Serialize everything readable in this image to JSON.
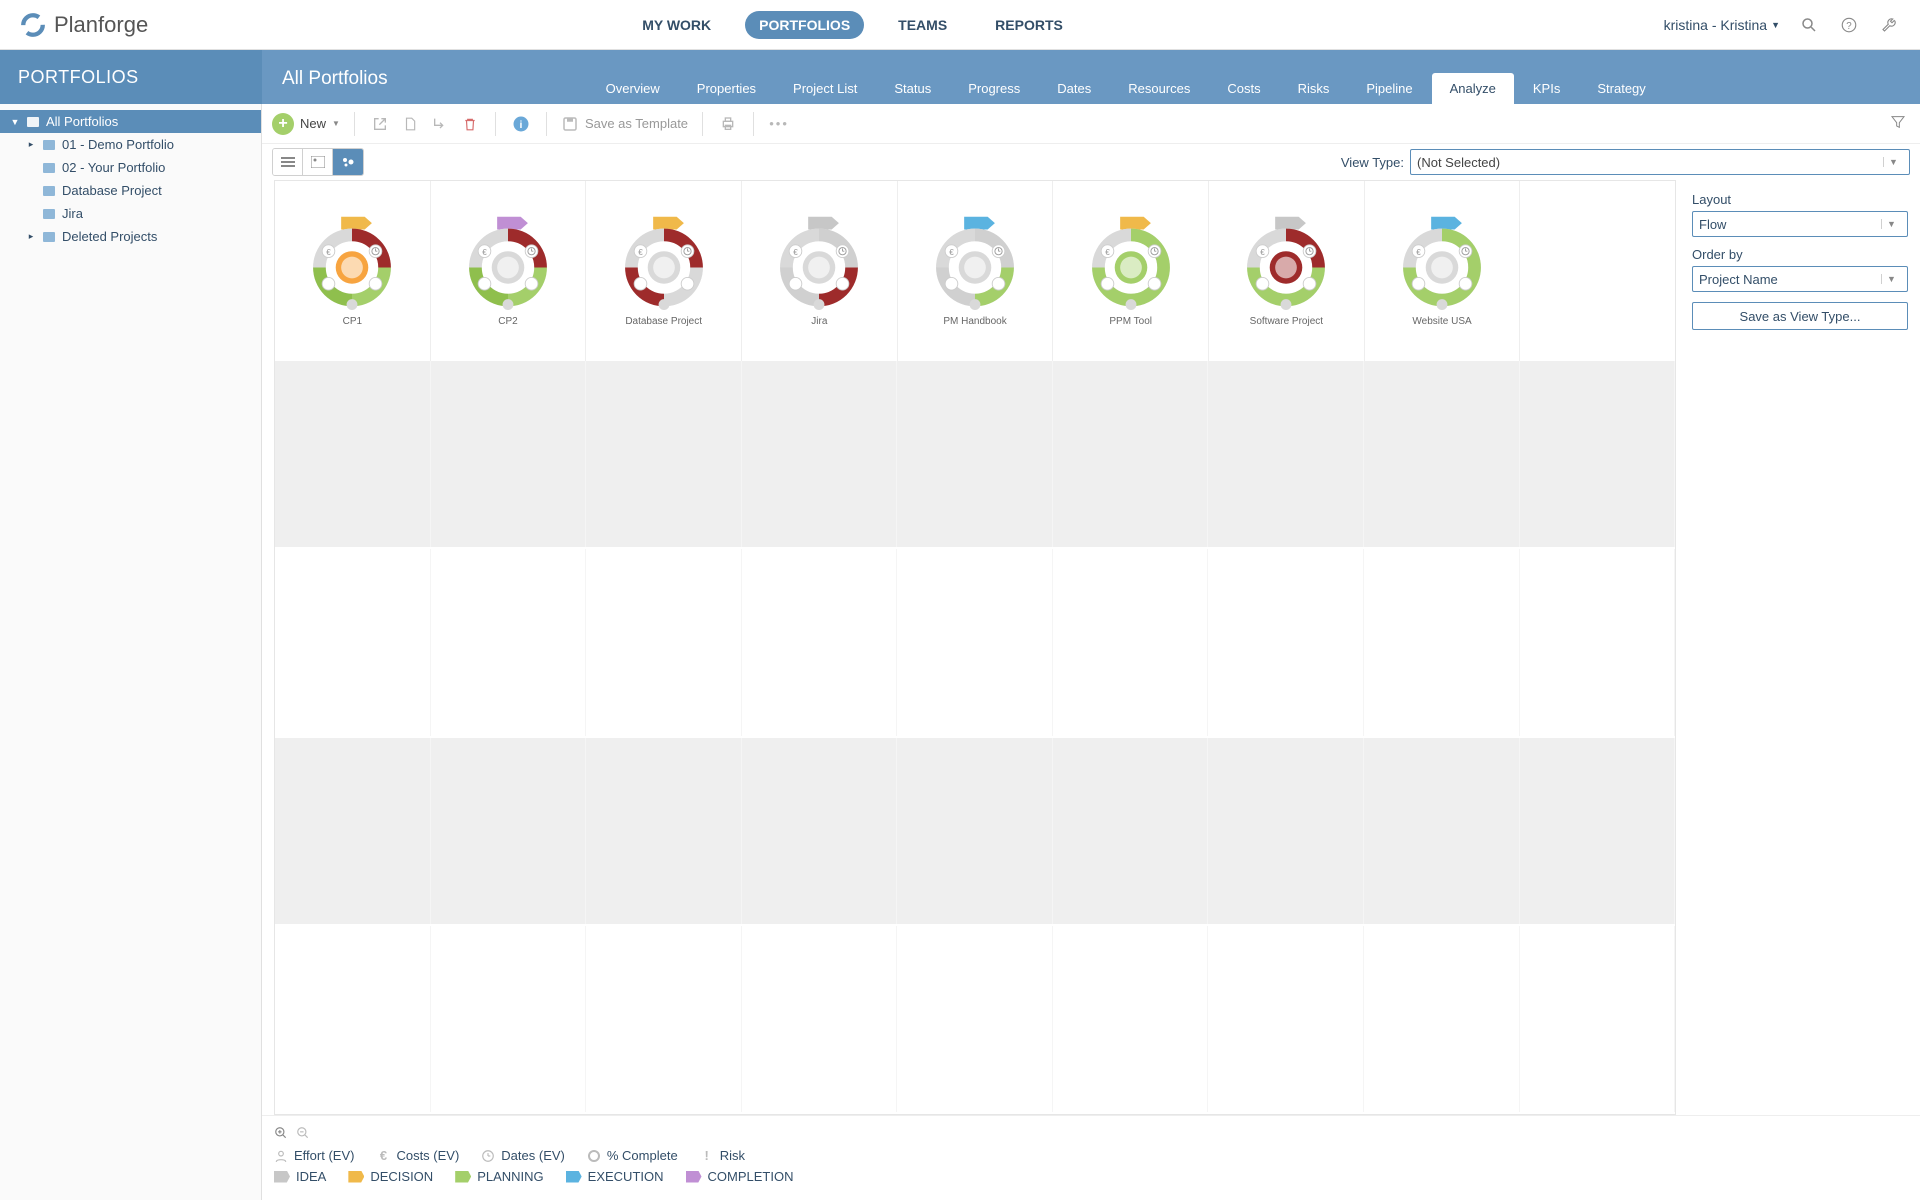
{
  "app": {
    "name": "Planforge"
  },
  "top_nav": {
    "items": [
      "MY WORK",
      "PORTFOLIOS",
      "TEAMS",
      "REPORTS"
    ],
    "active": "PORTFOLIOS"
  },
  "user": {
    "display": "kristina - Kristina"
  },
  "sidebar": {
    "title": "PORTFOLIOS",
    "root": "All Portfolios",
    "items": [
      {
        "label": "01 - Demo Portfolio",
        "expandable": true
      },
      {
        "label": "02 - Your Portfolio",
        "expandable": false
      },
      {
        "label": "Database Project",
        "expandable": false
      },
      {
        "label": "Jira",
        "expandable": false
      },
      {
        "label": "Deleted Projects",
        "expandable": true
      }
    ]
  },
  "page": {
    "title": "All Portfolios",
    "tabs": [
      "Overview",
      "Properties",
      "Project List",
      "Status",
      "Progress",
      "Dates",
      "Resources",
      "Costs",
      "Risks",
      "Pipeline",
      "Analyze",
      "KPIs",
      "Strategy"
    ],
    "active_tab": "Analyze"
  },
  "toolbar": {
    "new_label": "New",
    "save_template_label": "Save as Template"
  },
  "view_bar": {
    "view_type_label": "View Type:",
    "view_type_value": "(Not Selected)"
  },
  "right_panel": {
    "layout_label": "Layout",
    "layout_value": "Flow",
    "order_label": "Order by",
    "order_value": "Project Name",
    "save_view_label": "Save as View Type..."
  },
  "projects": [
    {
      "name": "CP1",
      "arrow": "#f0b94a",
      "seg1": "#9e2b2b",
      "seg2": "#a4cf6a",
      "seg3": "#f7a440",
      "seg4": "#8fbf4d"
    },
    {
      "name": "CP2",
      "arrow": "#c08fd4",
      "seg1": "#9e2b2b",
      "seg2": "#a4cf6a",
      "seg3": "#d9d9d9",
      "seg4": "#8fbf4d"
    },
    {
      "name": "Database Project",
      "arrow": "#f0b94a",
      "seg1": "#9e2b2b",
      "seg2": "#d9d9d9",
      "seg3": "#d9d9d9",
      "seg4": "#9e2b2b"
    },
    {
      "name": "Jira",
      "arrow": "#c7c7c7",
      "seg1": "#d0d0d0",
      "seg2": "#9e2b2b",
      "seg3": "#d9d9d9",
      "seg4": "#d0d0d0"
    },
    {
      "name": "PM Handbook",
      "arrow": "#5bb3e0",
      "seg1": "#d0d0d0",
      "seg2": "#a4cf6a",
      "seg3": "#d9d9d9",
      "seg4": "#d0d0d0"
    },
    {
      "name": "PPM Tool",
      "arrow": "#f0b94a",
      "seg1": "#a4cf6a",
      "seg2": "#a4cf6a",
      "seg3": "#a4cf6a",
      "seg4": "#a4cf6a"
    },
    {
      "name": "Software Project",
      "arrow": "#c7c7c7",
      "seg1": "#9e2b2b",
      "seg2": "#a4cf6a",
      "seg3": "#9e2b2b",
      "seg4": "#a4cf6a"
    },
    {
      "name": "Website USA",
      "arrow": "#5bb3e0",
      "seg1": "#a4cf6a",
      "seg2": "#a4cf6a",
      "seg3": "#d9d9d9",
      "seg4": "#a4cf6a"
    }
  ],
  "legend": {
    "row1": [
      {
        "icon": "person",
        "label": "Effort (EV)"
      },
      {
        "icon": "euro",
        "label": "Costs (EV)"
      },
      {
        "icon": "clock",
        "label": "Dates (EV)"
      },
      {
        "icon": "circle",
        "label": "% Complete"
      },
      {
        "icon": "excl",
        "label": "Risk"
      }
    ],
    "row2": [
      {
        "color": "#c7c7c7",
        "label": "IDEA"
      },
      {
        "color": "#f0b94a",
        "label": "DECISION"
      },
      {
        "color": "#a4cf6a",
        "label": "PLANNING"
      },
      {
        "color": "#5bb3e0",
        "label": "EXECUTION"
      },
      {
        "color": "#c08fd4",
        "label": "COMPLETION"
      }
    ]
  }
}
